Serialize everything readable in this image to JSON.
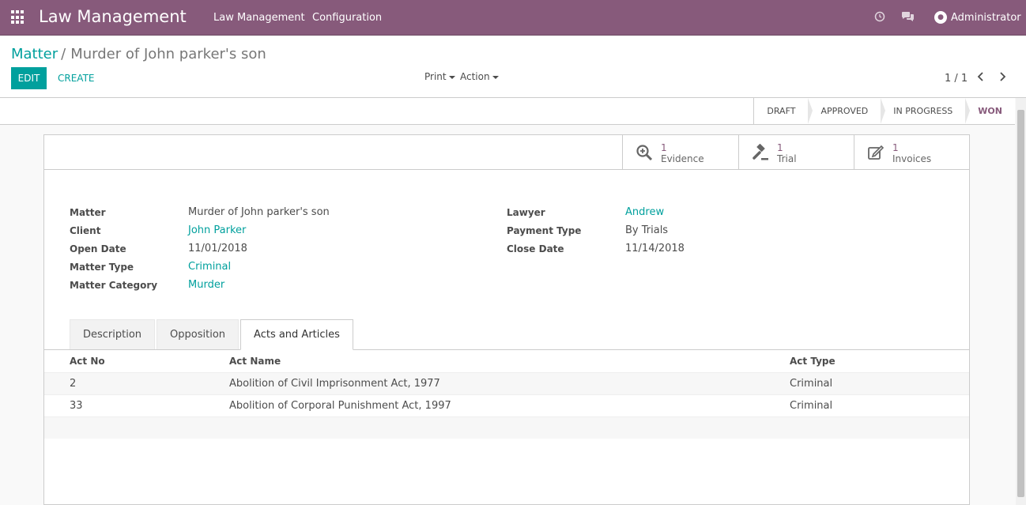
{
  "navbar": {
    "app_title": "Law Management",
    "menu": [
      "Law Management",
      "Configuration"
    ],
    "user": "Administrator"
  },
  "breadcrumb": {
    "parent": "Matter",
    "separator": "/",
    "current": "Murder of John parker's son"
  },
  "toolbar": {
    "edit_label": "EDIT",
    "create_label": "CREATE",
    "print_label": "Print",
    "action_label": "Action"
  },
  "pager": {
    "value": "1 / 1"
  },
  "status_stages": [
    "DRAFT",
    "APPROVED",
    "IN PROGRESS",
    "WON"
  ],
  "active_stage": "WON",
  "smart_buttons": [
    {
      "count": "1",
      "label": "Evidence",
      "icon": "search-plus-icon"
    },
    {
      "count": "1",
      "label": "Trial",
      "icon": "gavel-icon"
    },
    {
      "count": "1",
      "label": "Invoices",
      "icon": "edit-icon"
    }
  ],
  "fields_left": [
    {
      "label": "Matter",
      "value": "Murder of John parker's son",
      "link": false
    },
    {
      "label": "Client",
      "value": "John Parker",
      "link": true
    },
    {
      "label": "Open Date",
      "value": "11/01/2018",
      "link": false
    },
    {
      "label": "Matter Type",
      "value": "Criminal",
      "link": true
    },
    {
      "label": "Matter Category",
      "value": "Murder",
      "link": true
    }
  ],
  "fields_right": [
    {
      "label": "Lawyer",
      "value": "Andrew",
      "link": true
    },
    {
      "label": "Payment Type",
      "value": "By Trials",
      "link": false
    },
    {
      "label": "Close Date",
      "value": "11/14/2018",
      "link": false
    }
  ],
  "tabs": [
    "Description",
    "Opposition",
    "Acts and Articles"
  ],
  "active_tab": "Acts and Articles",
  "acts_table": {
    "columns": [
      "Act No",
      "Act Name",
      "Act Type"
    ],
    "rows": [
      [
        "2",
        "Abolition of Civil Imprisonment Act, 1977",
        "Criminal"
      ],
      [
        "33",
        "Abolition of Corporal Punishment Act, 1997",
        "Criminal"
      ]
    ]
  },
  "colors": {
    "primary": "#875a7b",
    "accent": "#00a09d"
  }
}
